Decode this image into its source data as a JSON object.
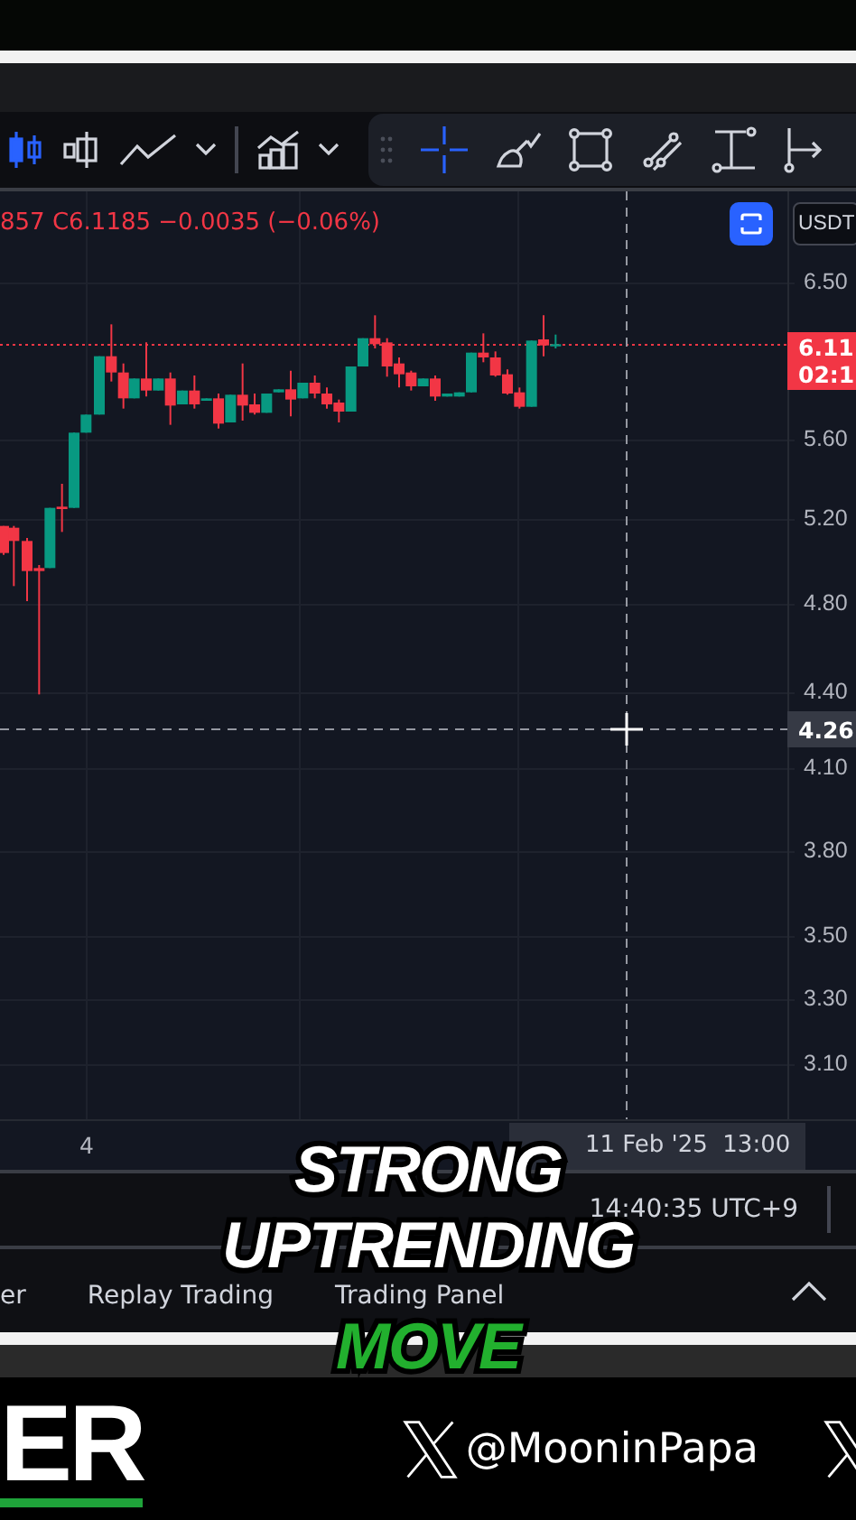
{
  "chart_toolbar": [
    {
      "kind": "candles",
      "selected": true
    },
    {
      "kind": "bars",
      "selected": false
    },
    {
      "kind": "line",
      "selected": false
    },
    {
      "kind": "caret",
      "selected": false
    },
    {
      "kind": "divider"
    },
    {
      "kind": "indicators",
      "selected": false
    },
    {
      "kind": "caret",
      "selected": false
    }
  ],
  "drawing_toolbar": [
    {
      "kind": "grip"
    },
    {
      "kind": "crosshair",
      "selected": true
    },
    {
      "kind": "brush",
      "selected": false
    },
    {
      "kind": "rectangle",
      "selected": false
    },
    {
      "kind": "trendline",
      "selected": false
    },
    {
      "kind": "anchor",
      "selected": false
    },
    {
      "kind": "measure",
      "selected": false
    }
  ],
  "legend": {
    "text": "857 C6.1185 −0.0035 (−0.06%)"
  },
  "currency": "USDT",
  "price_axis": [
    "6.50",
    "5.60",
    "5.20",
    "4.80",
    "4.40",
    "4.10",
    "3.80",
    "3.50",
    "3.30",
    "3.10"
  ],
  "last_price": {
    "price": "6.11",
    "countdown": "02:1"
  },
  "crosshair_price": "4.26",
  "time_axis": {
    "tick": "4",
    "crosshair_time": "11 Feb '25  13:00"
  },
  "status_bar": {
    "clock": "14:40:35 UTC+9"
  },
  "bottom_tabs": [
    {
      "label": "er",
      "selected": false
    },
    {
      "label": "Replay Trading",
      "selected": false
    },
    {
      "label": "Trading Panel",
      "selected": false
    }
  ],
  "captions": [
    {
      "text": "STRONG",
      "kind": "white"
    },
    {
      "text": "UPTRENDING",
      "kind": "white"
    },
    {
      "text": "MOVE",
      "kind": "green"
    }
  ],
  "footer": {
    "brand": "ER",
    "handle": "@MooninPapa"
  }
}
